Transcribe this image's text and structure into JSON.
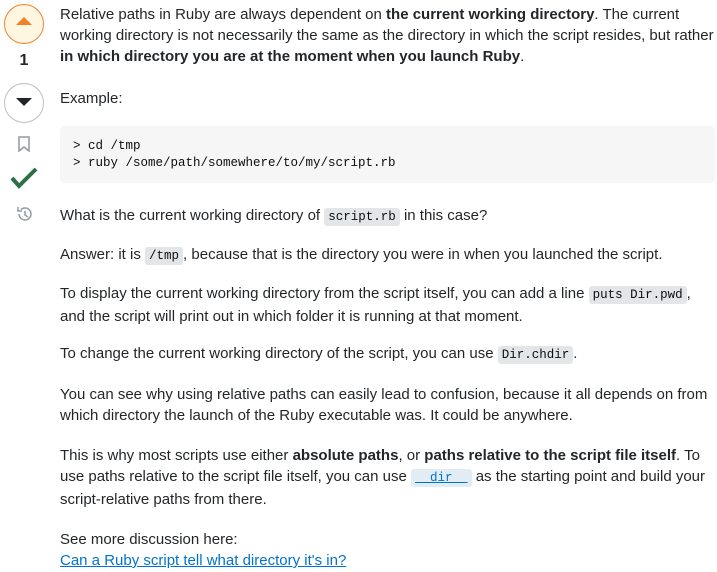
{
  "vote": {
    "score": "1"
  },
  "post": {
    "p1": {
      "t1": "Relative paths in Ruby are always dependent on ",
      "b1": "the current working directory",
      "t2": ". The current working directory is not necessarily the same as the directory in which the script resides, but rather ",
      "b2": "in which directory you are at the moment when you launch Ruby",
      "t3": "."
    },
    "example_label": "Example:",
    "code_lines": [
      "> cd /tmp",
      "> ruby /some/path/somewhere/to/my/script.rb"
    ],
    "q": {
      "t1": "What is the current working directory of ",
      "code": "script.rb",
      "t2": " in this case?"
    },
    "answer": {
      "t1": "Answer: it is ",
      "code": "/tmp",
      "t2": ", because that is the directory you were in when you launched the script."
    },
    "display": {
      "t1": "To display the current working directory from the script itself, you can add a line ",
      "code": "puts Dir.pwd",
      "t2": ", and the script will print out in which folder it is running at that moment."
    },
    "change": {
      "t1": "To change the current working directory of the script, you can use ",
      "code": "Dir.chdir",
      "t2": "."
    },
    "confusion": "You can see why using relative paths can easily lead to confusion, because it all depends on from which directory the launch of the Ruby executable was. It could be anywhere.",
    "why": {
      "t1": "This is why most scripts use either ",
      "b1": "absolute paths",
      "t2": ", or ",
      "b2": "paths relative to the script file itself",
      "t3": ". To use paths relative to the script file itself, you can use ",
      "code": "__dir__",
      "t4": " as the starting point and build your script-relative paths from there."
    },
    "see_more": "See more discussion here:",
    "link": "Can a Ruby script tell what directory it's in?"
  },
  "colors": {
    "upvote_accent": "#f48225",
    "accepted": "#2f6f44",
    "link": "#0074cc"
  },
  "icons": [
    "caret-up-icon",
    "caret-down-icon",
    "bookmark-icon",
    "checkmark-icon",
    "history-icon"
  ]
}
